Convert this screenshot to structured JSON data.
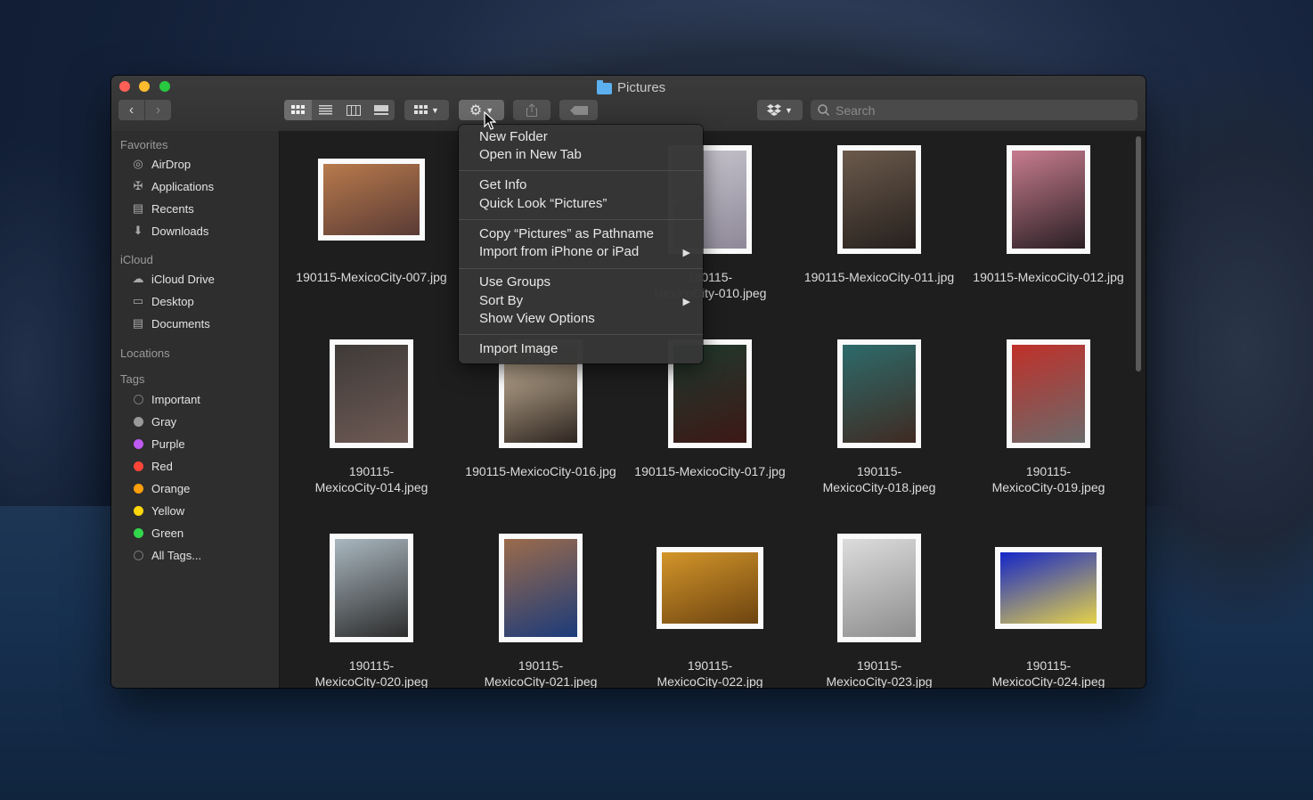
{
  "window": {
    "title": "Pictures"
  },
  "toolbar": {
    "search_placeholder": "Search"
  },
  "sidebar": {
    "favorites_label": "Favorites",
    "favorites": [
      "AirDrop",
      "Applications",
      "Recents",
      "Downloads"
    ],
    "icloud_label": "iCloud",
    "icloud": [
      "iCloud Drive",
      "Desktop",
      "Documents"
    ],
    "locations_label": "Locations",
    "tags_label": "Tags",
    "tags": [
      {
        "label": "Important",
        "color": "hollow"
      },
      {
        "label": "Gray",
        "color": "#9a9a9a"
      },
      {
        "label": "Purple",
        "color": "#bf5af2"
      },
      {
        "label": "Red",
        "color": "#ff453a"
      },
      {
        "label": "Orange",
        "color": "#ff9f0a"
      },
      {
        "label": "Yellow",
        "color": "#ffd60a"
      },
      {
        "label": "Green",
        "color": "#32d74b"
      },
      {
        "label": "All Tags...",
        "color": "hollow"
      }
    ]
  },
  "files": [
    {
      "line1": "190115-MexicoCity-007.jpg",
      "line2": "",
      "colors": [
        "#b87a4c",
        "#5a3b35"
      ]
    },
    {
      "line1": "190115-",
      "line2": "MexicoCity-010.jpeg",
      "colors": [
        "#c9c6cf",
        "#8e8898"
      ]
    },
    {
      "line1": "190115-MexicoCity-011.jpg",
      "line2": "",
      "colors": [
        "#6b5a4c",
        "#26201d"
      ]
    },
    {
      "line1": "190115-MexicoCity-012.jpg",
      "line2": "",
      "colors": [
        "#c77c8e",
        "#2a1f24"
      ]
    },
    {
      "line1": "190115-",
      "line2": "MexicoCity-014.jpeg",
      "colors": [
        "#3e3a38",
        "#6e5a54"
      ]
    },
    {
      "line1": "190115-MexicoCity-016.jpg",
      "line2": "",
      "colors": [
        "#d7c3a6",
        "#2e2520"
      ]
    },
    {
      "line1": "190115-MexicoCity-017.jpg",
      "line2": "",
      "colors": [
        "#1f3a2e",
        "#3d1816"
      ]
    },
    {
      "line1": "190115-",
      "line2": "MexicoCity-018.jpeg",
      "colors": [
        "#2d6b6b",
        "#3f2a22"
      ]
    },
    {
      "line1": "190115-",
      "line2": "MexicoCity-019.jpeg",
      "colors": [
        "#c0302a",
        "#6a6a6a"
      ]
    },
    {
      "line1": "190115-",
      "line2": "MexicoCity-020.jpeg",
      "colors": [
        "#a9b7bf",
        "#2c2c2c"
      ]
    },
    {
      "line1": "190115-",
      "line2": "MexicoCity-021.jpeg",
      "colors": [
        "#9b6b4b",
        "#1c3b7a"
      ]
    },
    {
      "line1": "190115-",
      "line2": "MexicoCity-022.jpg",
      "colors": [
        "#d3952a",
        "#6d4410"
      ]
    },
    {
      "line1": "190115-",
      "line2": "MexicoCity-023.jpg",
      "colors": [
        "#dcdcdc",
        "#8d8d8d"
      ]
    },
    {
      "line1": "190115-",
      "line2": "MexicoCity-024.jpeg",
      "colors": [
        "#1426c8",
        "#e5d24a"
      ]
    }
  ],
  "context_menu": {
    "items": [
      "New Folder",
      "Open in New Tab",
      "Get Info",
      "Quick Look “Pictures”",
      "Copy “Pictures” as Pathname",
      "Import from iPhone or iPad",
      "Use Groups",
      "Sort By",
      "Show View Options",
      "Import Image"
    ],
    "submenu_arrow": "▶"
  }
}
